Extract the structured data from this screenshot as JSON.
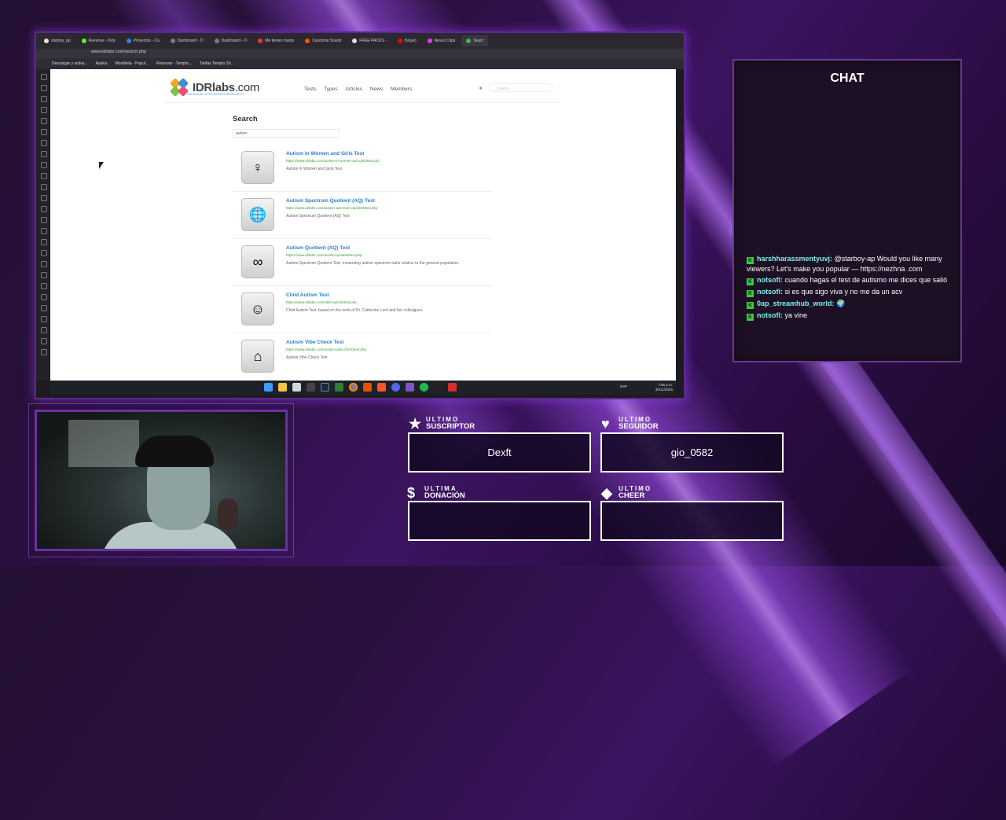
{
  "browser": {
    "tabs": [
      {
        "label": "starboy_ap",
        "color": "#e0e0e0"
      },
      {
        "label": "Revenue - Kick",
        "color": "#53fc18"
      },
      {
        "label": "Proyectos - Ca",
        "color": "#2f80ed"
      },
      {
        "label": "Dashboard - O",
        "color": "#7c7c7c"
      },
      {
        "label": "Dashboard - O",
        "color": "#7c7c7c"
      },
      {
        "label": "Me tienes mamo",
        "color": "#e53935"
      },
      {
        "label": "Canciona Sound",
        "color": "#ff5500"
      },
      {
        "label": "FREE PACKS -",
        "color": "#e0e0e0"
      },
      {
        "label": "(Nuye)",
        "color": "#ff0000"
      },
      {
        "label": "Nexus Clips",
        "color": "#e040fb"
      },
      {
        "label": "Searc",
        "color": "#4caf50"
      }
    ],
    "url": "www.idrlabs.com/search.php",
    "bookmarks": [
      "Descargar y activa...",
      "Ayalus",
      "Moetlistia - Popul...",
      "Reservar - Templo...",
      "Tarifas Templo Sh..."
    ],
    "taskbar": {
      "lang": "ESP",
      "time": "7:55 p.m.",
      "date": "30/11/2025"
    }
  },
  "site": {
    "logo": "IDRlabs",
    "logo_suffix": ".com",
    "logo_sub": "INDIVIDUAL DIFFERENCES RESEARCH",
    "nav": [
      "Tests",
      "Types",
      "Articles",
      "News",
      "Members"
    ],
    "search_placeholder": "Search...",
    "heading": "Search",
    "query": "autism",
    "results": [
      {
        "title": "Autism in Women and Girls Test",
        "url": "https://www.idrlabs.com/autism-in-women-and-girls/test.php",
        "desc": "Autism in Women and Girls Test",
        "icon": "♀"
      },
      {
        "title": "Autism Spectrum Quotient (AQ) Test",
        "url": "https://www.idrlabs.com/autism-spectrum-quotient/test.php",
        "desc": "Autism Spectrum Quotient (AQ) Test",
        "icon": "🌐"
      },
      {
        "title": "Autism Quotient (AQ) Test",
        "url": "https://www.idrlabs.com/autism-quotient/test.php",
        "desc": "Autism Spectrum Quotient Test, measuring autism spectrum traits relative to the general population.",
        "icon": "∞"
      },
      {
        "title": "Child Autism Test",
        "url": "https://www.idrlabs.com/child-autism/test.php",
        "desc": "Child Autism Test, based on the work of Dr. Catherine Lord and her colleagues.",
        "icon": "☺"
      },
      {
        "title": "Autism Vibe Check Test",
        "url": "https://www.idrlabs.com/autism-vibe-check/test.php",
        "desc": "Autism Vibe Check Test",
        "icon": "⌂"
      }
    ]
  },
  "chat": {
    "title": "CHAT",
    "messages": [
      {
        "user": "harshharassmentyuvj",
        "text": "@starboy-ap Would you like many viewers? Let's make you popular — https://nezhna .com"
      },
      {
        "user": "notsofi",
        "text": "cuando hagas el test de autismo me dices que salió"
      },
      {
        "user": "notsofi",
        "text": "si es que sigo viva y no me da un acv"
      },
      {
        "user": "0ap_streamhub_world",
        "text": "🌍"
      },
      {
        "user": "notsofi",
        "text": "ya vine"
      }
    ]
  },
  "alerts": {
    "subscriber": {
      "small": "ULTIMO",
      "big": "SUSCRIPTOR",
      "value": "Dexft"
    },
    "follower": {
      "small": "ULTIMO",
      "big": "SEGUIDOR",
      "value": "gio_0582"
    },
    "donation": {
      "small": "ULTIMA",
      "big": "DONACIÓN",
      "value": ""
    },
    "cheer": {
      "small": "ULTIMO",
      "big": "CHEER",
      "value": ""
    }
  }
}
